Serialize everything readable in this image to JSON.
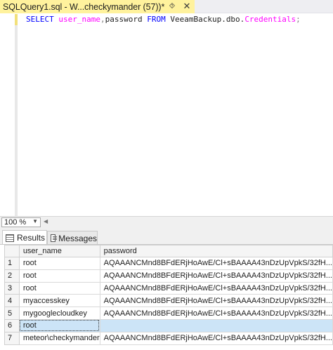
{
  "document_tab": {
    "title": "SQLQuery1.sql - W...checkymander (57))*",
    "pin_icon": "pin-icon",
    "close_icon": "close-icon"
  },
  "editor": {
    "tokens": {
      "select": "SELECT",
      "user_name": "user_name",
      "comma": ",",
      "password": "password",
      "from": "FROM",
      "table_prefix": "VeeamBackup.dbo.",
      "table_name": "Credentials",
      "semicolon": ";"
    }
  },
  "zoom": {
    "value": "100 %"
  },
  "results_tabs": {
    "results_label": "Results",
    "messages_label": "Messages"
  },
  "grid": {
    "columns": [
      "user_name",
      "password"
    ],
    "rows": [
      {
        "n": "1",
        "user_name": "root",
        "password": "AQAAANCMnd8BFdERjHoAwE/Cl+sBAAAA43nDzUpVpkS/32fH..."
      },
      {
        "n": "2",
        "user_name": "root",
        "password": "AQAAANCMnd8BFdERjHoAwE/Cl+sBAAAA43nDzUpVpkS/32fH..."
      },
      {
        "n": "3",
        "user_name": "root",
        "password": "AQAAANCMnd8BFdERjHoAwE/Cl+sBAAAA43nDzUpVpkS/32fH..."
      },
      {
        "n": "4",
        "user_name": "myaccesskey",
        "password": "AQAAANCMnd8BFdERjHoAwE/Cl+sBAAAA43nDzUpVpkS/32fH..."
      },
      {
        "n": "5",
        "user_name": "mygooglecloudkey",
        "password": "AQAAANCMnd8BFdERjHoAwE/Cl+sBAAAA43nDzUpVpkS/32fH..."
      },
      {
        "n": "6",
        "user_name": "root",
        "password": ""
      },
      {
        "n": "7",
        "user_name": "meteor\\checkymander",
        "password": "AQAAANCMnd8BFdERjHoAwE/Cl+sBAAAA43nDzUpVpkS/32fH..."
      }
    ],
    "selected_row": 6,
    "colors": {
      "selection": "#cce4f7",
      "tab_highlight": "#fff29d"
    }
  }
}
